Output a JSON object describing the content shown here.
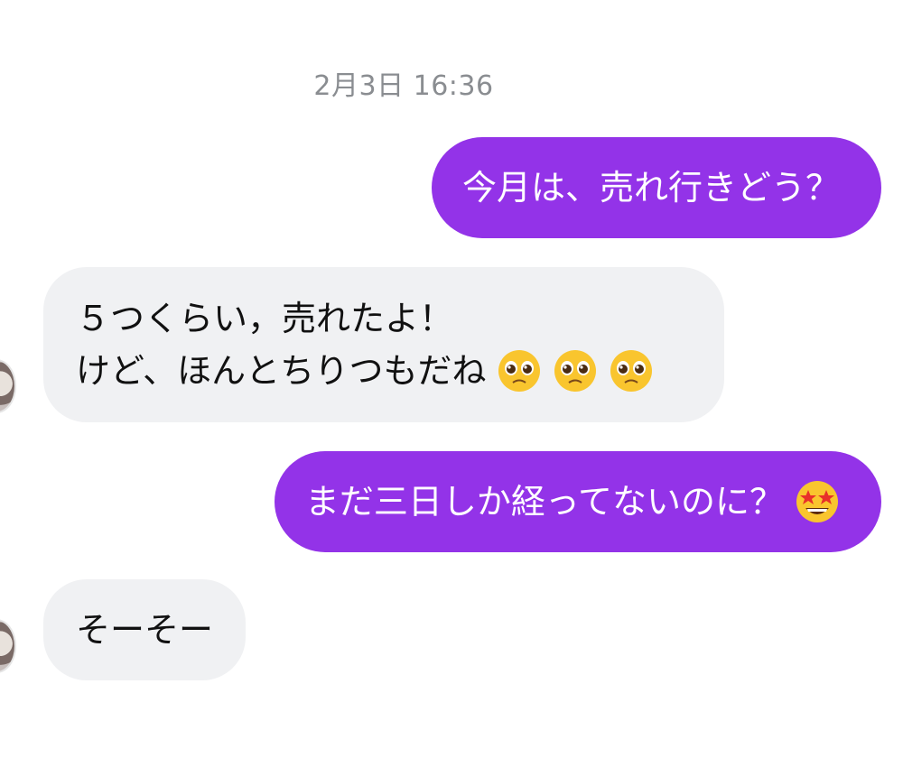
{
  "conversation": {
    "timestamp": "2月3日 16:36",
    "messages": [
      {
        "direction": "outgoing",
        "text": "今月は、売れ行きどう？"
      },
      {
        "direction": "incoming",
        "lines": [
          "５つくらい，売れたよ！",
          "けど、ほんとちりつもだね"
        ],
        "emojis": [
          "pleading-face",
          "pleading-face",
          "pleading-face"
        ]
      },
      {
        "direction": "outgoing",
        "text": "まだ三日しか経ってないのに？",
        "emojis": [
          "star-struck"
        ]
      },
      {
        "direction": "incoming",
        "text": "そーそー"
      }
    ]
  },
  "colors": {
    "outgoing_bubble": "#9333e8",
    "incoming_bubble": "#f0f1f3",
    "timestamp_text": "#8a8d91"
  }
}
